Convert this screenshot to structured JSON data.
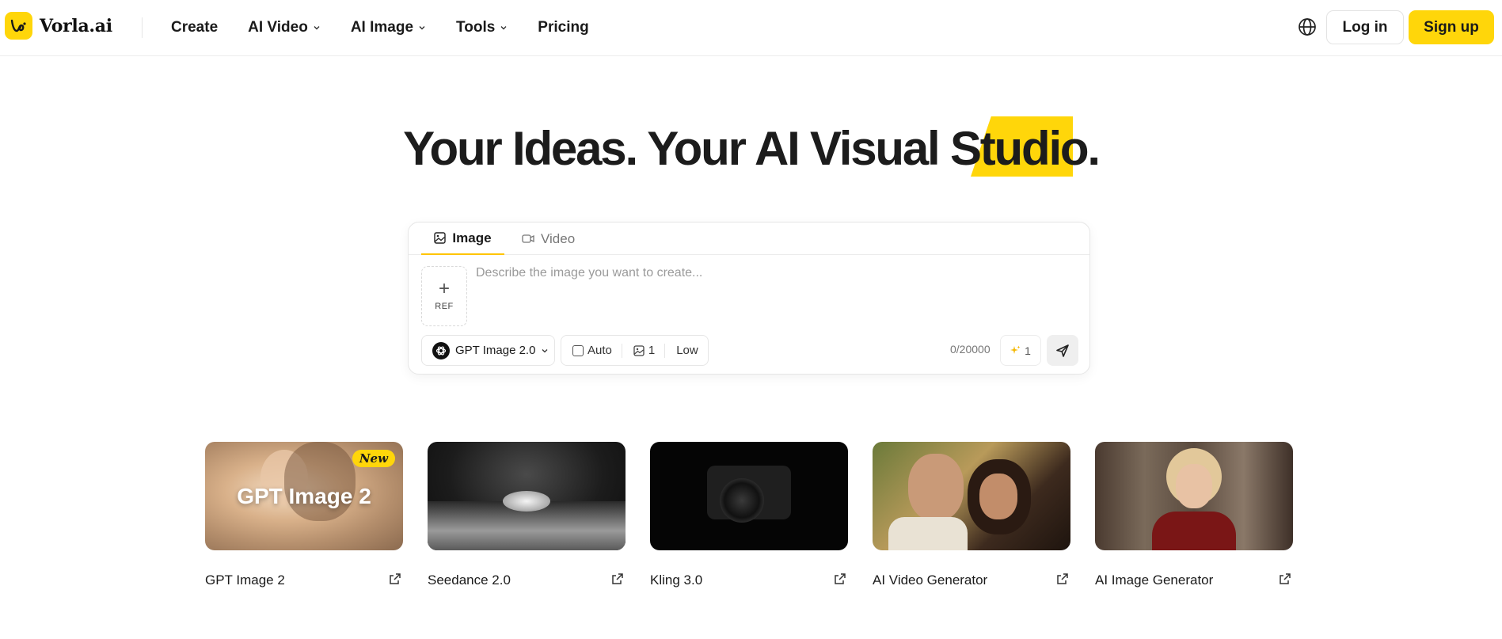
{
  "header": {
    "brand": "Vorla.ai",
    "nav": [
      {
        "label": "Create",
        "has_dropdown": false
      },
      {
        "label": "AI Video",
        "has_dropdown": true
      },
      {
        "label": "AI Image",
        "has_dropdown": true
      },
      {
        "label": "Tools",
        "has_dropdown": true
      },
      {
        "label": "Pricing",
        "has_dropdown": false
      }
    ],
    "login_label": "Log in",
    "signup_label": "Sign up",
    "globe_icon": "globe-icon"
  },
  "hero": {
    "title": "Your Ideas. Your AI Visual Studio."
  },
  "prompt": {
    "tabs": [
      {
        "label": "Image",
        "icon": "image-icon",
        "active": true
      },
      {
        "label": "Video",
        "icon": "video-icon",
        "active": false
      }
    ],
    "ref_label": "REF",
    "placeholder": "Describe the image you want to create...",
    "value": "",
    "model": "GPT Image 2.0",
    "aspect": "Auto",
    "count": "1",
    "quality": "Low",
    "char_count": "0/20000",
    "credits": "1"
  },
  "cards": [
    {
      "label": "GPT Image 2",
      "overlay": "GPT Image 2",
      "badge": "New"
    },
    {
      "label": "Seedance 2.0",
      "overlay": "",
      "badge": ""
    },
    {
      "label": "Kling 3.0",
      "overlay": "",
      "badge": ""
    },
    {
      "label": "AI Video Generator",
      "overlay": "",
      "badge": ""
    },
    {
      "label": "AI Image Generator",
      "overlay": "",
      "badge": ""
    }
  ],
  "colors": {
    "accent": "#ffd60a",
    "text": "#1a1a1a",
    "border": "#e6e6e6"
  }
}
